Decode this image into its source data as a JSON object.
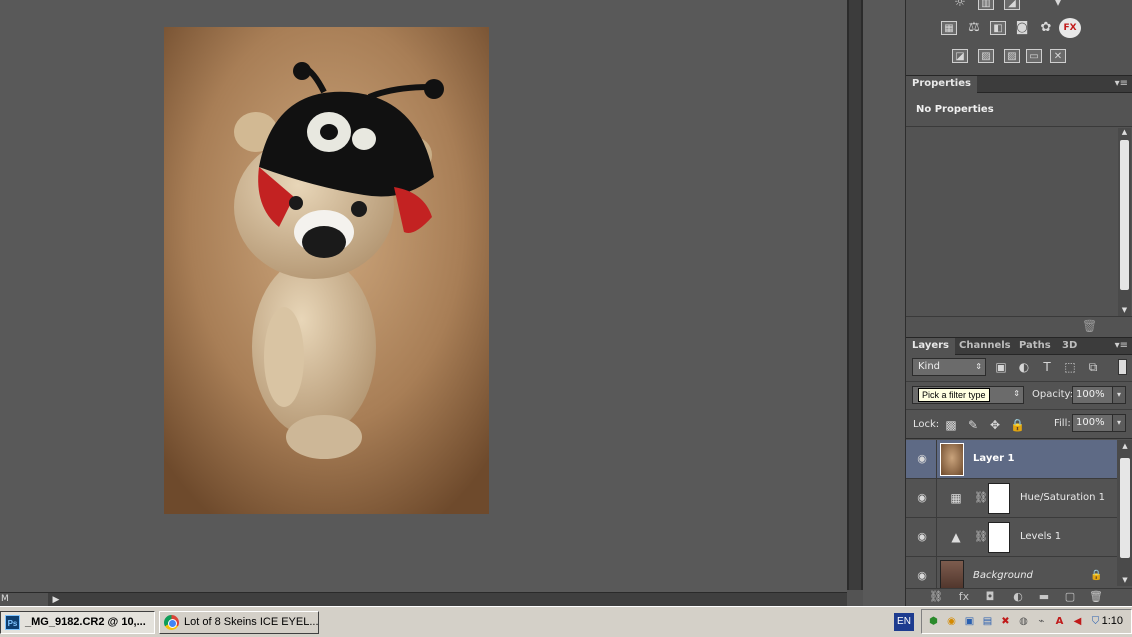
{
  "canvas": {
    "status_left": "M",
    "status_arrow": "▶"
  },
  "properties": {
    "tab": "Properties",
    "title": "No Properties"
  },
  "layers": {
    "tabs": [
      "Layers",
      "Channels",
      "Paths",
      "3D"
    ],
    "kind_label": "Kind",
    "filter_tooltip": "Pick a filter type",
    "opacity_label": "Opacity:",
    "opacity_value": "100%",
    "lock_label": "Lock:",
    "fill_label": "Fill:",
    "fill_value": "100%",
    "rows": [
      {
        "name": "Layer 1",
        "selected": true
      },
      {
        "name": "Hue/Saturation 1",
        "selected": false
      },
      {
        "name": "Levels 1",
        "selected": false
      },
      {
        "name": "Background",
        "selected": false
      }
    ]
  },
  "taskbar": {
    "items": [
      {
        "label": "_MG_9182.CR2 @ 10,...",
        "icon": "Ps"
      },
      {
        "label": "Lot of 8 Skeins ICE EYEL...",
        "icon": "chrome"
      }
    ],
    "language": "EN",
    "clock": "1:10"
  },
  "colors": {
    "panel_bg": "#535353",
    "selected_layer": "#5e6a85",
    "tooltip_bg": "#ffffe1",
    "taskbar_bg": "#d4d0c8"
  }
}
